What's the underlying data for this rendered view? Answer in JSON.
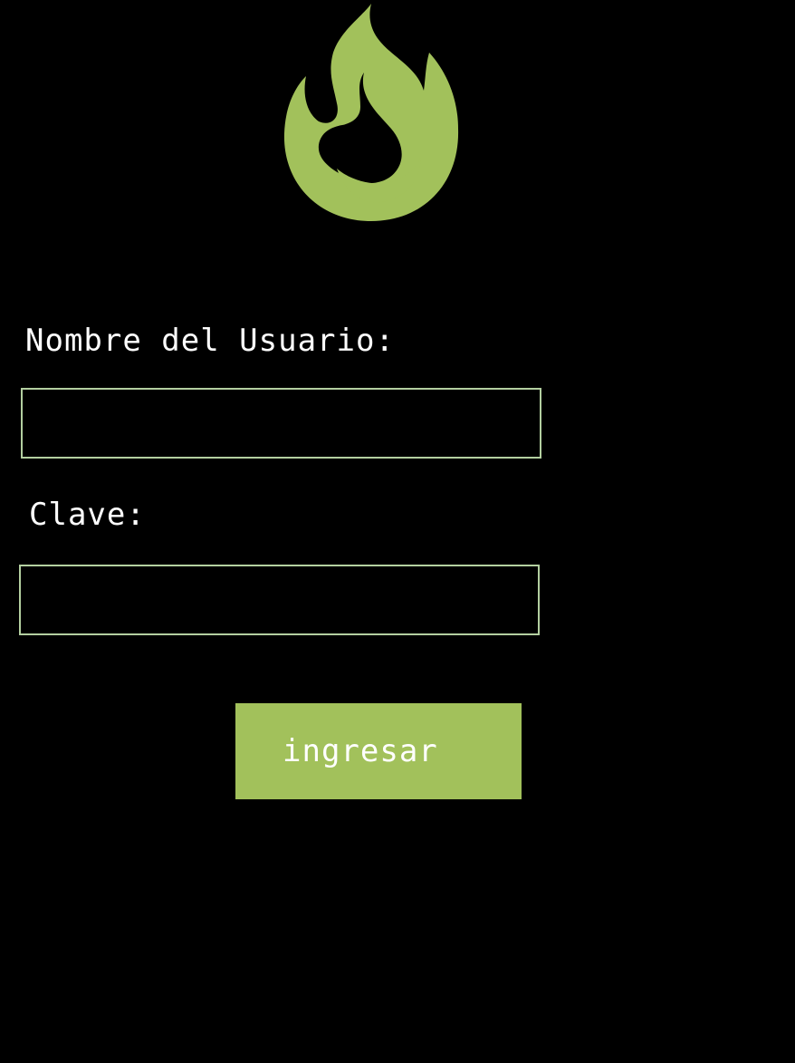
{
  "logo": {
    "icon": "flame-icon",
    "color": "#a2c15b"
  },
  "form": {
    "username_label": "Nombre del Usuario:",
    "username_value": "",
    "password_label": "Clave:",
    "password_value": "",
    "submit_label": "ingresar"
  },
  "colors": {
    "background": "#000000",
    "accent": "#a2c15b",
    "input_border": "#b3cfa0",
    "text": "#ffffff"
  }
}
